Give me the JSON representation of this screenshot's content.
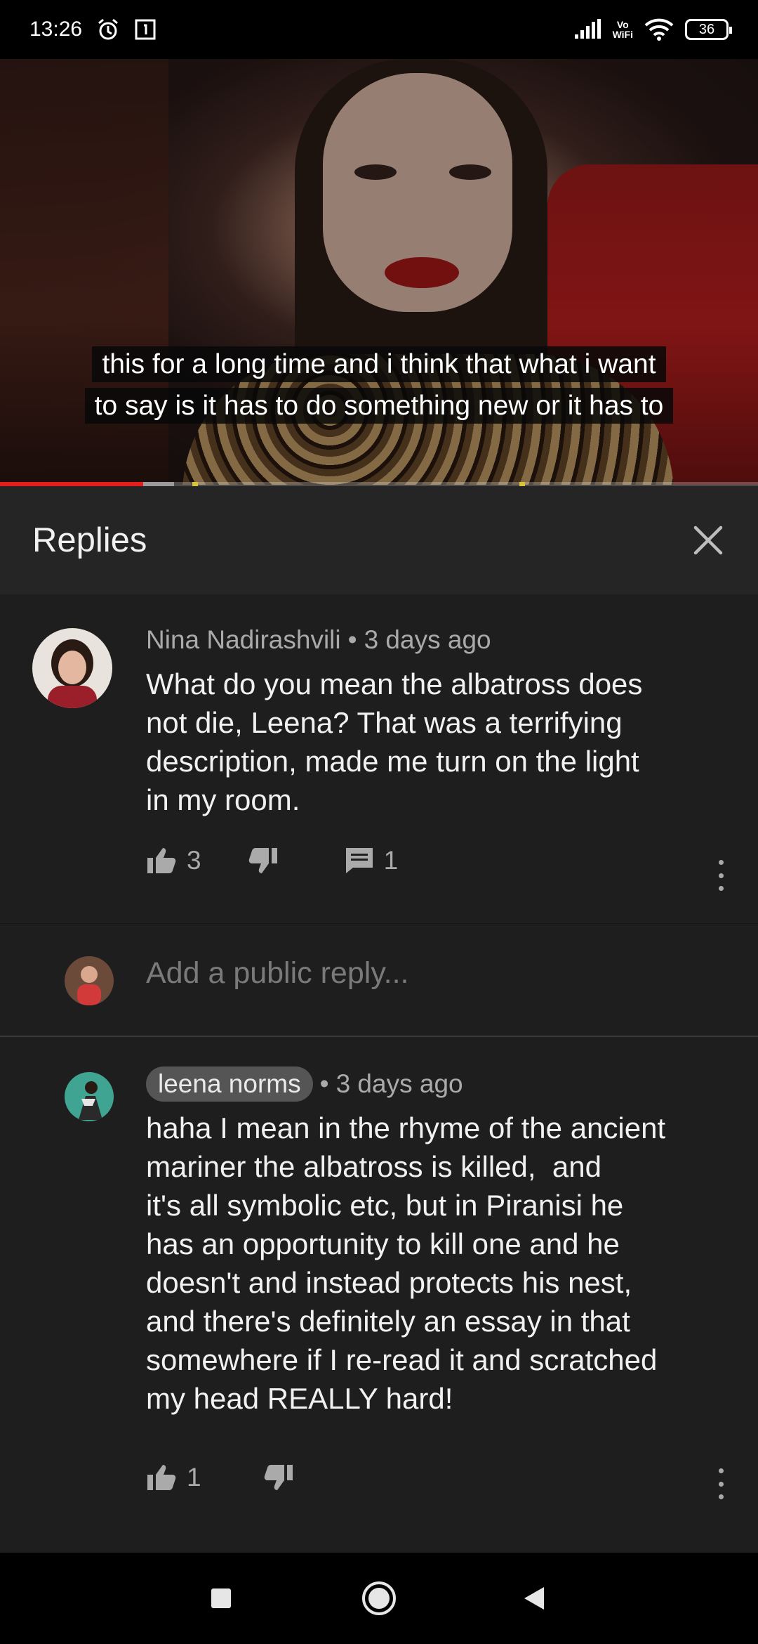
{
  "status_bar": {
    "time": "13:26",
    "battery": "36",
    "network_label": "Vo\nWiFi",
    "icons": [
      "alarm-icon",
      "notification-box-icon",
      "signal-icon",
      "vowifi-icon",
      "wifi-icon",
      "battery-icon"
    ]
  },
  "video": {
    "caption_line1": "this for a long time and i think that what i want",
    "caption_line2": "to say is it has to do something new or it has to",
    "progress_played_fraction": 0.19
  },
  "panel": {
    "title": "Replies"
  },
  "comments": [
    {
      "author": "Nina Nadirashvili",
      "time": "3 days ago",
      "text": "What do you mean the albatross does\nnot die, Leena? That was a terrifying\ndescription, made me turn on the light\nin my room.",
      "likes": "3",
      "replies": "1"
    },
    {
      "author": "leena norms",
      "time": "3 days ago",
      "text": "haha I mean in the rhyme of the ancient\nmariner the albatross is killed,  and\nit's all symbolic etc, but in Piranisi he\nhas an opportunity to kill one and he\ndoesn't and instead protects his nest,\nand there's definitely an essay in that\nsomewhere if I re-read it and scratched\nmy head REALLY hard!",
      "likes": "1"
    }
  ],
  "reply_box": {
    "placeholder": "Add a public reply..."
  },
  "separator": "•"
}
